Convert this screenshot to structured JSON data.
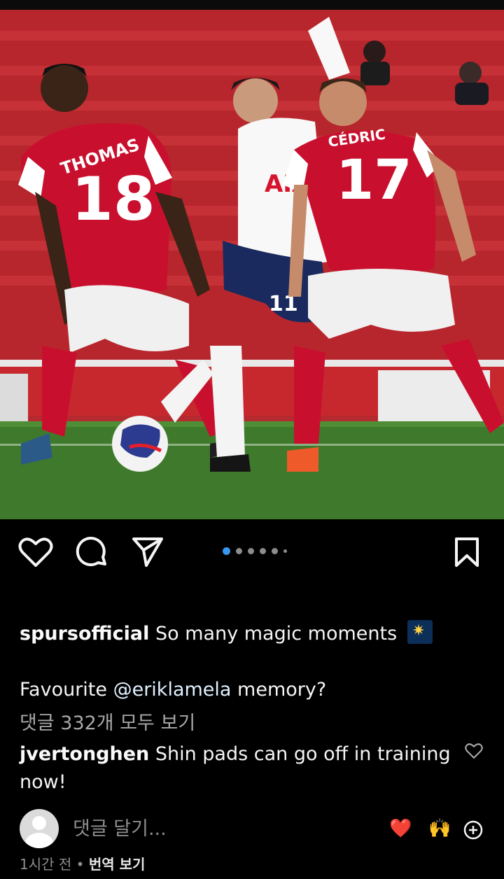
{
  "post": {
    "image_alt": "",
    "jerseys": {
      "left": {
        "name": "THOMAS",
        "number": "18"
      },
      "right": {
        "name": "CÉDRIC",
        "number": "17"
      },
      "center": {
        "number": "11",
        "sponsor": "AIA"
      }
    },
    "carousel": {
      "count": 6,
      "active_index": 0
    }
  },
  "actions": {
    "like_icon": "heart-outline-icon",
    "comment_icon": "speech-bubble-icon",
    "share_icon": "paper-plane-icon",
    "save_icon": "bookmark-icon"
  },
  "caption": {
    "username": "spursofficial",
    "text": "So many magic moments",
    "emoji": "sparkler-emoji",
    "line2_before": "Favourite ",
    "mention": "@eriklamela",
    "line2_after": " memory?"
  },
  "comments": {
    "view_all": "댓글 332개 모두 보기",
    "top": {
      "username": "jvertonghen",
      "text": "Shin pads can go off in training now!"
    }
  },
  "add_comment": {
    "placeholder": "댓글 달기...",
    "quick_reactions": [
      "❤️",
      "🙌"
    ]
  },
  "meta": {
    "time": "1시간 전",
    "separator": "•",
    "translate": "번역 보기"
  },
  "colors": {
    "background": "#000000",
    "active_dot": "#3897f0",
    "arsenal_red": "#c8102e"
  }
}
